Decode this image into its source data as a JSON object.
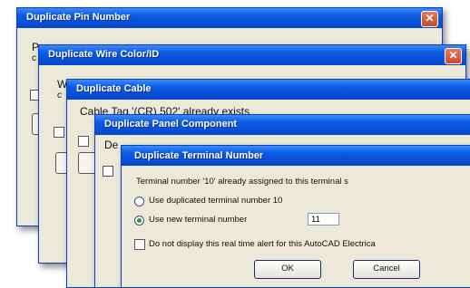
{
  "dialogs": [
    {
      "title": "Duplicate Pin Number",
      "fragments": [
        "P",
        "c"
      ]
    },
    {
      "title": "Duplicate Wire Color/ID",
      "fragments": [
        "W",
        "c"
      ]
    },
    {
      "title": "Duplicate Cable",
      "fragments": [
        "Cable Tag '(CR) 502' already exists"
      ]
    },
    {
      "title": "Duplicate Panel Component",
      "fragments": [
        "De"
      ]
    },
    {
      "title": "Duplicate Terminal Number"
    }
  ],
  "front": {
    "message": "Terminal number '10' already assigned to this terminal s",
    "option_use_duplicated": "Use duplicated terminal number 10",
    "option_use_new": "Use new terminal number",
    "new_number_value": "11",
    "checkbox_label": "Do not display this real time alert for this AutoCAD Electrica",
    "ok_label": "OK",
    "cancel_label": "Cancel"
  },
  "icons": {
    "close": "close-icon"
  }
}
